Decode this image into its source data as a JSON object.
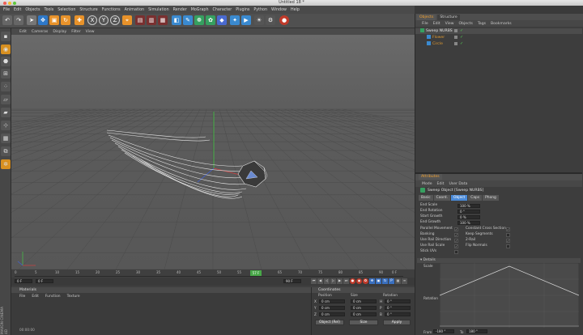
{
  "window": {
    "title": "Untitled 18 *"
  },
  "menu": [
    "File",
    "Edit",
    "Objects",
    "Tools",
    "Selection",
    "Structure",
    "Functions",
    "Animation",
    "Simulation",
    "Render",
    "MoGraph",
    "Character",
    "Plugins",
    "Python",
    "Window",
    "Help"
  ],
  "viewport": {
    "menu": [
      "Edit",
      "Cameras",
      "Display",
      "Filter",
      "View"
    ],
    "label": "Perspective"
  },
  "timeline": {
    "ticks": [
      "0",
      "5",
      "10",
      "15",
      "20",
      "25",
      "30",
      "35",
      "40",
      "45",
      "50",
      "55",
      "60",
      "65",
      "70",
      "75",
      "80",
      "85",
      "90"
    ],
    "frame_start": "0 F",
    "frame_current": "0 F",
    "frame_end": "90 F",
    "frame_badge": "57 F",
    "frame_total": "0 F"
  },
  "materials": {
    "title": "Materials",
    "menu": [
      "File",
      "Edit",
      "Function",
      "Texture"
    ],
    "status": "00:00:00"
  },
  "coordinates": {
    "title": "Coordinates",
    "headers": [
      "Position",
      "Size",
      "Rotation"
    ],
    "rows": [
      {
        "axis": "X",
        "pos": "0 cm",
        "size": "0 cm",
        "rot_label": "H",
        "rot": "0 °"
      },
      {
        "axis": "Y",
        "pos": "0 cm",
        "size": "0 cm",
        "rot_label": "P",
        "rot": "0 °"
      },
      {
        "axis": "Z",
        "pos": "0 cm",
        "size": "0 cm",
        "rot_label": "B",
        "rot": "0 °"
      }
    ],
    "mode": "Object (Rel)",
    "size_mode": "Size",
    "apply": "Apply"
  },
  "objects_panel": {
    "tabs": [
      "Objects",
      "Structure"
    ],
    "menu": [
      "File",
      "Edit",
      "View",
      "Objects",
      "Tags",
      "Bookmarks"
    ],
    "items": [
      {
        "name": "Sweep NURBS",
        "level": 0,
        "color": "#e0e0e0"
      },
      {
        "name": "Flower",
        "level": 1,
        "color": "#e09a30"
      },
      {
        "name": "Circle",
        "level": 1,
        "color": "#e09a30"
      }
    ]
  },
  "attributes": {
    "title": "Attributes",
    "menu": [
      "Mode",
      "Edit",
      "User Data"
    ],
    "object_name": "Sweep Object [Sweep NURBS]",
    "tabs": [
      "Basic",
      "Coord.",
      "Object",
      "Caps",
      "Phong"
    ],
    "active_tab": "Object",
    "fields": [
      {
        "label": "End Scale",
        "value": "100 %"
      },
      {
        "label": "End Rotation",
        "value": "0 °"
      },
      {
        "label": "Start Growth",
        "value": "0 %"
      },
      {
        "label": "End Growth",
        "value": "100 %"
      }
    ],
    "checks_left": [
      {
        "label": "Parallel Movement",
        "checked": true
      },
      {
        "label": "Banking",
        "checked": true
      },
      {
        "label": "Use Rail Direction",
        "checked": true
      },
      {
        "label": "Use Rail Scale",
        "checked": true
      },
      {
        "label": "Stick UVs",
        "checked": false
      }
    ],
    "checks_right": [
      {
        "label": "Constant Cross Section",
        "checked": true
      },
      {
        "label": "Keep Segments",
        "checked": false
      },
      {
        "label": "2-Rail",
        "checked": true
      },
      {
        "label": "Flip Normals",
        "checked": false
      }
    ],
    "details_label": "Details",
    "scale_label": "Scale",
    "rotation_label": "Rotation",
    "from_label": "From",
    "from_value": "-180 °",
    "to_label": "To",
    "to_value": "180 °"
  },
  "brand": "MAXON CINEMA 4D",
  "colors": {
    "accent": "#f0a030",
    "viewport_bg": "#5d5d5d",
    "panel_bg": "#3d3d3d"
  }
}
